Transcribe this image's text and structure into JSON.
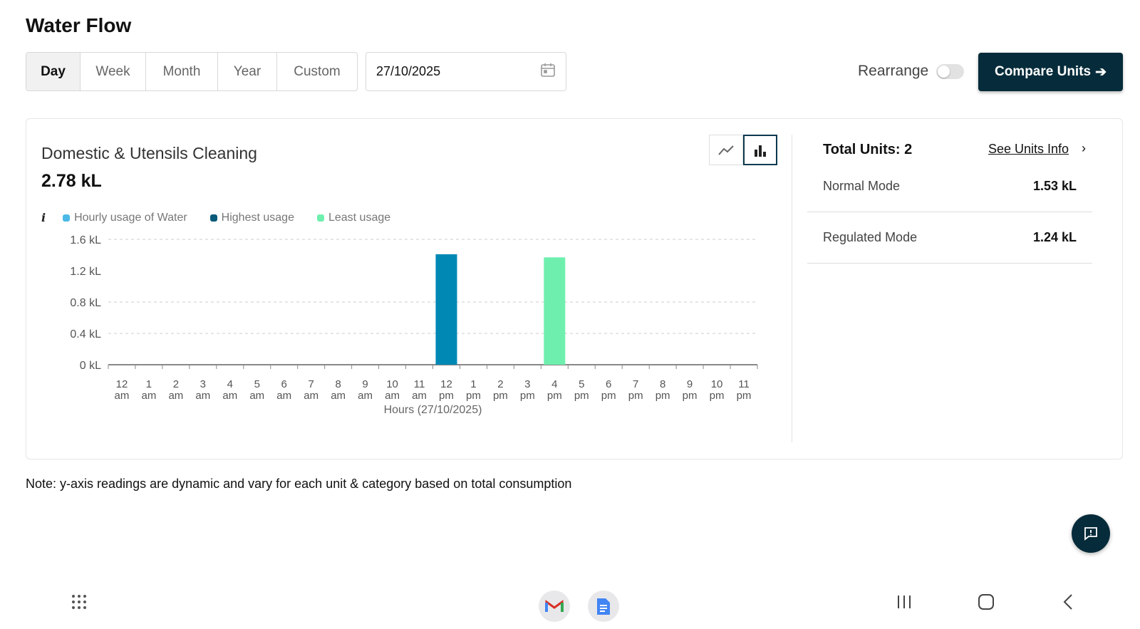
{
  "header": {
    "title": "Water Flow"
  },
  "tabs": [
    {
      "label": "Day",
      "active": true
    },
    {
      "label": "Week"
    },
    {
      "label": "Month"
    },
    {
      "label": "Year"
    },
    {
      "label": "Custom"
    }
  ],
  "date": {
    "value": "27/10/2025",
    "icon": "calendar-icon"
  },
  "rearrange": {
    "label": "Rearrange",
    "on": false
  },
  "compare_button": {
    "label": "Compare Units"
  },
  "card": {
    "title": "Domestic & Utensils Cleaning",
    "total": "2.78 kL"
  },
  "units": {
    "total_label": "Total Units: 2",
    "see_info": "See Units Info",
    "rows": [
      {
        "label": "Normal Mode",
        "value": "1.53 kL"
      },
      {
        "label": "Regulated Mode",
        "value": "1.24 kL"
      }
    ]
  },
  "legend": [
    {
      "label": "Hourly usage of Water",
      "color": "#4bb8e6"
    },
    {
      "label": "Highest usage",
      "color": "#0a5a7a"
    },
    {
      "label": "Least usage",
      "color": "#6eefae"
    }
  ],
  "chart_data": {
    "type": "bar",
    "categories": [
      "12 am",
      "1 am",
      "2 am",
      "3 am",
      "4 am",
      "5 am",
      "6 am",
      "7 am",
      "8 am",
      "9 am",
      "10 am",
      "11 am",
      "12 pm",
      "1 pm",
      "2 pm",
      "3 pm",
      "4 pm",
      "5 pm",
      "6 pm",
      "7 pm",
      "8 pm",
      "9 pm",
      "10 pm",
      "11 pm"
    ],
    "values": [
      0,
      0,
      0,
      0,
      0,
      0,
      0,
      0,
      0,
      0,
      0,
      0,
      1.41,
      0,
      0,
      0,
      1.37,
      0,
      0,
      0,
      0,
      0,
      0,
      0
    ],
    "bar_colors": {
      "12 pm": "#0088b5",
      "4 pm": "#6eefae"
    },
    "xlabel": "Hours (27/10/2025)",
    "ylabel": "",
    "ylim": [
      0,
      1.6
    ],
    "yticks": [
      "1.6 kL",
      "1.2 kL",
      "0.8 kL",
      "0.4 kL",
      "0 kL"
    ],
    "ytick_values": [
      1.6,
      1.2,
      0.8,
      0.4,
      0
    ],
    "grid": true
  },
  "note": "Note: y-axis readings are dynamic and vary for each unit & category based on total consumption"
}
